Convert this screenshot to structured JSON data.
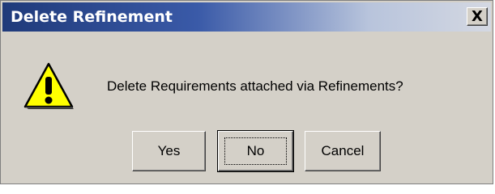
{
  "dialog": {
    "title": "Delete Refinement",
    "close_glyph": "X",
    "icon": "warning-icon",
    "message": "Delete Requirements attached via Refinements?",
    "buttons": {
      "yes": "Yes",
      "no": "No",
      "cancel": "Cancel"
    },
    "default_button": "No"
  },
  "colors": {
    "titlebar_start": "#1f3a7a",
    "titlebar_end": "#d4d8e2",
    "dialog_face": "#d4d0c8",
    "warning_yellow": "#ffff00"
  }
}
